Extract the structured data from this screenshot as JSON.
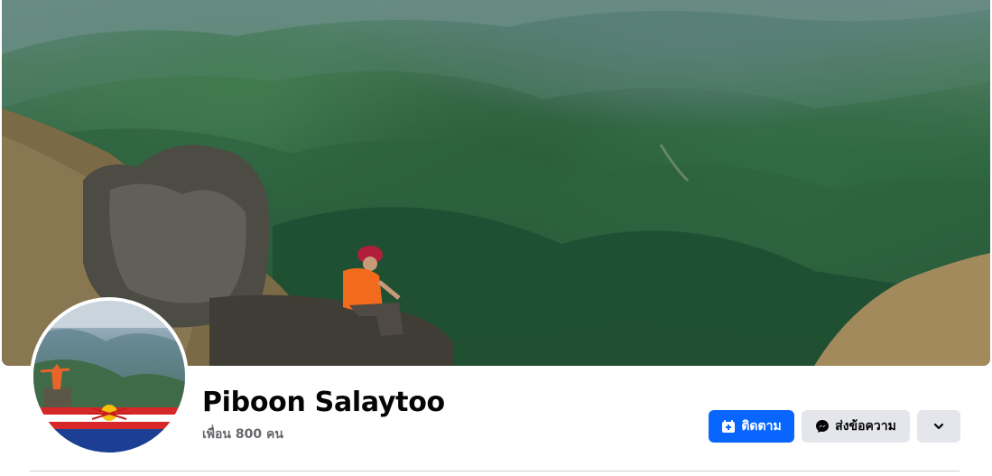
{
  "profile": {
    "name": "Piboon Salaytoo",
    "friends_text": "เพื่อน 800 คน"
  },
  "actions": {
    "follow_label": "ติดตาม",
    "message_label": "ส่งข้อความ"
  },
  "icons": {
    "follow": "follow-icon",
    "message": "messenger-icon",
    "more": "chevron-down-icon"
  },
  "colors": {
    "primary_button": "#0866ff",
    "secondary_button": "#e4e6eb",
    "name_text": "#050505",
    "muted_text": "#65676b"
  }
}
